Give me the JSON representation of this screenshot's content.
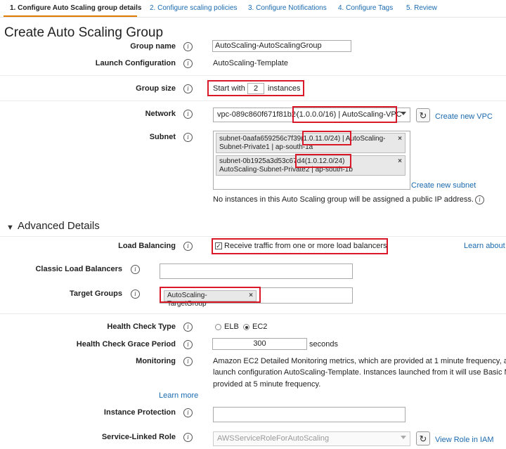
{
  "tabs": [
    {
      "label": "1. Configure Auto Scaling group details",
      "active": true
    },
    {
      "label": "2. Configure scaling policies",
      "active": false
    },
    {
      "label": "3. Configure Notifications",
      "active": false
    },
    {
      "label": "4. Configure Tags",
      "active": false
    },
    {
      "label": "5. Review",
      "active": false
    }
  ],
  "page_title": "Create Auto Scaling Group",
  "info_icon_glyph": "i",
  "form": {
    "group_name": {
      "label": "Group name",
      "value": "AutoScaling-AutoScalingGroup"
    },
    "launch_configuration": {
      "label": "Launch Configuration",
      "value": "AutoScaling-Template"
    },
    "group_size": {
      "label": "Group size",
      "prefix": "Start with",
      "value": "2",
      "suffix": "instances"
    },
    "network": {
      "label": "Network",
      "vpc_id": "vpc-089c860f671f81b2e",
      "vpc_label": "(1.0.0.0/16) | AutoScaling-VPC",
      "create_link": "Create new VPC"
    },
    "subnet": {
      "label": "Subnet",
      "chips": [
        {
          "line1_id": "subnet-0aafa659256c7f39",
          "line1_cidr": "(1.0.11.0/24)",
          "line1_rest": "| AutoScaling-",
          "line2": "Subnet-Private1 | ap-south-1a"
        },
        {
          "line1_id": "subnet-0b1925a3d53c67d4",
          "line1_cidr": "(1.0.12.0/24)",
          "line1_rest": "",
          "line2": "AutoScaling-Subnet-Private2 | ap-south-1b"
        }
      ],
      "create_link": "Create new subnet",
      "note": "No instances in this Auto Scaling group will be assigned a public IP address."
    }
  },
  "advanced": {
    "section_title": "Advanced Details",
    "load_balancing": {
      "label": "Load Balancing",
      "checkbox_text": "Receive traffic from one or more load balancers",
      "checked": true,
      "learn_link": "Learn about"
    },
    "classic_lb": {
      "label": "Classic Load Balancers",
      "value": ""
    },
    "target_groups": {
      "label": "Target Groups",
      "chip": "AutoScaling-TargetGroup"
    },
    "health_check_type": {
      "label": "Health Check Type",
      "options": [
        "ELB",
        "EC2"
      ],
      "selected": "EC2"
    },
    "grace_period": {
      "label": "Health Check Grace Period",
      "value": "300",
      "unit": "seconds"
    },
    "monitoring": {
      "label": "Monitoring",
      "line1": "Amazon EC2 Detailed Monitoring metrics, which are provided at 1 minute frequency, a",
      "line2": "launch configuration AutoScaling-Template. Instances launched from it will use Basic M",
      "line3": "provided at 5 minute frequency.",
      "learn_link": "Learn more"
    },
    "instance_protection": {
      "label": "Instance Protection",
      "value": ""
    },
    "service_linked_role": {
      "label": "Service-Linked Role",
      "value": "AWSServiceRoleForAutoScaling",
      "view_link": "View Role in IAM"
    }
  },
  "colors": {
    "highlight": "#d9182a",
    "link": "#1a6aaf",
    "active_tab_underline": "#e07b00"
  }
}
